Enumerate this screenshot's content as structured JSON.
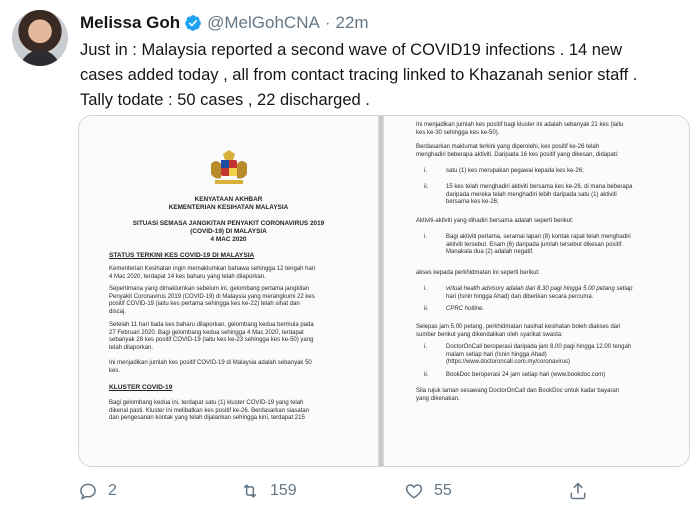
{
  "tweet": {
    "display_name": "Melissa Goh",
    "handle": "@MelGohCNA",
    "separator": "·",
    "time": "22m",
    "text_lines": [
      "Just in : Malaysia reported a second wave of COVID19 infections . 14 new",
      "cases added today , all from contact tracing linked to Khazanah senior staff .",
      "Tally todate : 50 cases , 22 discharged ."
    ]
  },
  "document": {
    "left": {
      "header_lines": [
        "KENYATAAN AKHBAR",
        "KEMENTERIAN KESIHATAN MALAYSIA"
      ],
      "subheader_lines": [
        "SITUASI SEMASA JANGKITAN PENYAKIT CORONAVIRUS 2019",
        "(COVID-19) DI MALAYSIA",
        "4 MAC 2020"
      ],
      "section1_title": "STATUS TERKINI KES COVID-19 DI MALAYSIA",
      "para1": [
        "Kementerian Kesihatan ingin memaklumkan bahawa sehingga 12 tengah hari",
        "4 Mac 2020, terdapat 14 kes baharu yang telah dilaporkan."
      ],
      "para2": [
        "Sepertimana yang dimaklumkan sebelum ini, gelombang pertama jangkitan",
        "Penyakit Coronavirus 2019 (COVID-19) di Malaysia yang merangkumi 22 kes",
        "positif COVID-19 (iaitu kes pertama sehingga kes ke-22) telah sihat dan",
        "discaj."
      ],
      "para3": [
        "Setelah 11 hari tiada kes baharu dilaporkan, gelombang kedua bermula pada",
        "27 Februari 2020. Bagi gelombang kedua sehingga 4 Mac 2020, terdapat",
        "sebanyak 28 kes positif COVID-19 (iaitu kes ke-23 sehingga kes ke-50) yang",
        "telah dilaporkan."
      ],
      "para4": [
        "Ini menjadikan jumlah kes positif COVID-19 di Malaysia adalah sebanyak 50",
        "kes."
      ],
      "section2_title": "KLUSTER COVID-19",
      "para5": [
        "Bagi gelombang kedua ini, terdapat satu (1) kluster COVID-19 yang telah",
        "dikenal pasti. Kluster ini melibatkan kes positif ke-26. Berdasarkan siasatan",
        "dan pengesanan kontak yang telah dijalankan sehingga kini, terdapat 215"
      ]
    },
    "right": {
      "para1": [
        "Ini menjadikan jumlah kes positif bagi kluster ini adalah sebanyak 21 kes (iaitu",
        "kes ke-30 sehingga kes ke-50)."
      ],
      "para2": [
        "Berdasarkan maklumat terkini yang diperolehi, kes positif ke-26 telah",
        "menghadiri beberapa aktiviti. Daripada 16 kes positif yang dikesan, didapati:"
      ],
      "item_i_num": "i.",
      "item_i": [
        "satu (1) kes merupakan pegawai kepada kes ke-26;"
      ],
      "item_ii_num": "ii.",
      "item_ii": [
        "15 kes telah menghadiri aktiviti bersama kes ke-26, di mana beberapa",
        "daripada mereka telah menghadiri lebih daripada satu (1) aktiviti",
        "bersama kes ke-26;"
      ],
      "para3": [
        "Aktiviti-aktiviti yang dihadiri bersama adalah seperti berikut:"
      ],
      "item_i2_num": "i.",
      "item_i2": [
        "Bagi aktiviti pertama, seramai lapan (8) kontak rapat telah menghadiri",
        "aktiviti tersebut. Enam (6) daripada jumlah tersebut dikesan positif.",
        "Manakala dua (2) adalah negatif."
      ],
      "para4": [
        "akses kepada perkhidmatan ini seperti berikut:"
      ],
      "item_i3_num": "i.",
      "item_i3": [
        "virtual health advisory adalah dari 8.30 pagi hingga 5.00 petang setiap",
        "hari (Isnin hingga Ahad) dan diberikan secara percuma."
      ],
      "item_ii3_num": "ii.",
      "item_ii3": [
        "CPRC hotline."
      ],
      "para5": [
        "Selepas jam 5.00 petang, perkhidmatan nasihat kesihatan boleh diakses dari",
        "sumber berikut yang dikendalikan oleh syarikat swasta:"
      ],
      "item_i4_num": "i.",
      "item_i4": [
        "DoctorOnCall beroperasi daripada jam 8.00 pagi hingga 12.00 tengah",
        "malam setiap hari (Isnin hingga Ahad)",
        "(https://www.doctoroncall.com.my/coronavirus)"
      ],
      "item_ii4_num": "ii.",
      "item_ii4": [
        "BookDoc beroperasi 24 jam setiap hari (www.bookdoc.com)"
      ],
      "para6": [
        "Sila rujuk laman sesawang DoctorOnCall dan BookDoc untuk kadar bayaran",
        "yang dikenakan."
      ]
    }
  },
  "actions": {
    "reply_count": "2",
    "retweet_count": "159",
    "like_count": "55"
  },
  "colors": {
    "verified": "#1da1f2",
    "muted": "#657786",
    "text": "#14171a"
  },
  "icons": [
    "verified-badge-icon",
    "reply-icon",
    "retweet-icon",
    "like-icon",
    "share-icon"
  ]
}
